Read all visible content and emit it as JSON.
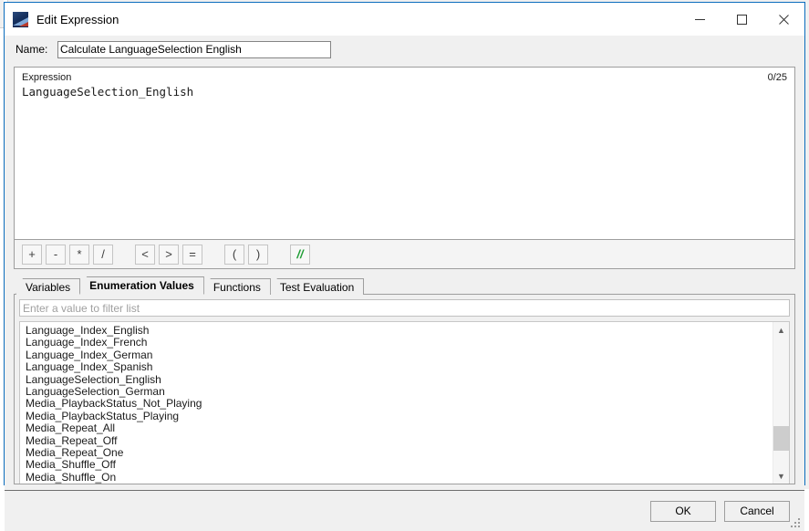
{
  "window": {
    "title": "Edit Expression",
    "icon": "app-icon",
    "controls": {
      "minimize": "minimize-icon",
      "maximize": "maximize-icon",
      "close": "close-icon"
    }
  },
  "name_field": {
    "label": "Name:",
    "value": "Calculate LanguageSelection English",
    "placeholder": ""
  },
  "expression_panel": {
    "label": "Expression",
    "counter": "0/25",
    "text": "LanguageSelection_English"
  },
  "operator_toolbar": {
    "buttons": [
      {
        "label": "+",
        "name": "op-plus-button",
        "style": "normal"
      },
      {
        "label": "-",
        "name": "op-minus-button",
        "style": "normal"
      },
      {
        "label": "*",
        "name": "op-multiply-button",
        "style": "normal"
      },
      {
        "label": "/",
        "name": "op-divide-button",
        "style": "normal"
      },
      {
        "label": "<",
        "name": "op-less-than-button",
        "style": "normal"
      },
      {
        "label": ">",
        "name": "op-greater-than-button",
        "style": "normal"
      },
      {
        "label": "=",
        "name": "op-equals-button",
        "style": "normal"
      },
      {
        "label": "(",
        "name": "op-open-paren-button",
        "style": "normal"
      },
      {
        "label": ")",
        "name": "op-close-paren-button",
        "style": "normal"
      },
      {
        "label": "//",
        "name": "op-comment-button",
        "style": "green"
      }
    ]
  },
  "tabs": [
    {
      "label": "Variables",
      "active": false
    },
    {
      "label": "Enumeration Values",
      "active": true
    },
    {
      "label": "Functions",
      "active": false
    },
    {
      "label": "Test Evaluation",
      "active": false
    }
  ],
  "filter": {
    "value": "",
    "placeholder": "Enter a value to filter list"
  },
  "enumeration_list": [
    "Language_Index_English",
    "Language_Index_French",
    "Language_Index_German",
    "Language_Index_Spanish",
    "LanguageSelection_English",
    "LanguageSelection_German",
    "Media_PlaybackStatus_Not_Playing",
    "Media_PlaybackStatus_Playing",
    "Media_Repeat_All",
    "Media_Repeat_Off",
    "Media_Repeat_One",
    "Media_Shuffle_Off",
    "Media_Shuffle_On"
  ],
  "footer": {
    "ok_label": "OK",
    "cancel_label": "Cancel"
  },
  "colors": {
    "window_border": "#0a6cbd",
    "dialog_bg": "#f0f0f0",
    "comment_green": "#1f9d35",
    "field_border": "#848484"
  }
}
